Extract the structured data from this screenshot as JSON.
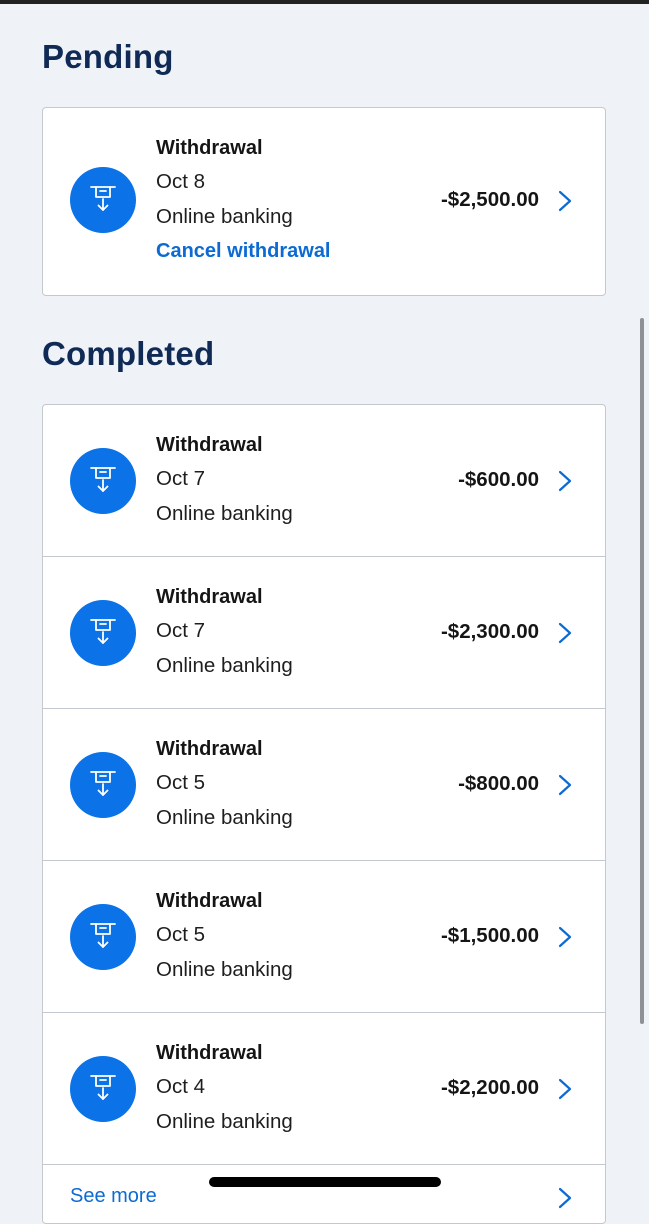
{
  "pending": {
    "title": "Pending",
    "item": {
      "title": "Withdrawal",
      "date": "Oct 8",
      "method": "Online banking",
      "cancel_label": "Cancel withdrawal",
      "amount": "-$2,500.00"
    }
  },
  "completed": {
    "title": "Completed",
    "items": [
      {
        "title": "Withdrawal",
        "date": "Oct 7",
        "method": "Online banking",
        "amount": "-$600.00"
      },
      {
        "title": "Withdrawal",
        "date": "Oct 7",
        "method": "Online banking",
        "amount": "-$2,300.00"
      },
      {
        "title": "Withdrawal",
        "date": "Oct 5",
        "method": "Online banking",
        "amount": "-$800.00"
      },
      {
        "title": "Withdrawal",
        "date": "Oct 5",
        "method": "Online banking",
        "amount": "-$1,500.00"
      },
      {
        "title": "Withdrawal",
        "date": "Oct 4",
        "method": "Online banking",
        "amount": "-$2,200.00"
      }
    ],
    "see_more_label": "See more"
  },
  "icons": {
    "transaction": "atm-withdrawal-icon",
    "row_action": "chevron-right-icon"
  },
  "colors": {
    "accent": "#0b72e7",
    "heading": "#0e2a55",
    "link": "#0b6bd3",
    "background": "#eff2f7"
  }
}
